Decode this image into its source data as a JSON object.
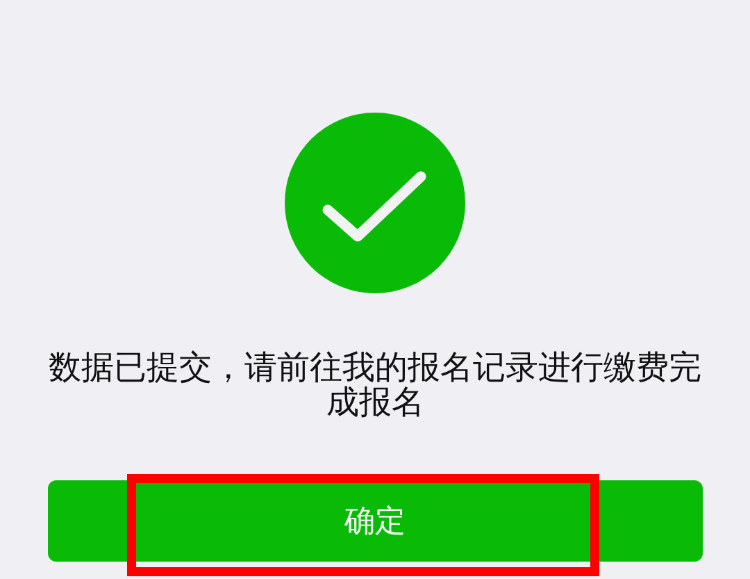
{
  "result": {
    "succeeded": true,
    "message": "数据已提交，请前往我的报名记录进行缴费完成报名"
  },
  "buttons": [
    {
      "label": "确定",
      "highlighted": true
    }
  ]
}
